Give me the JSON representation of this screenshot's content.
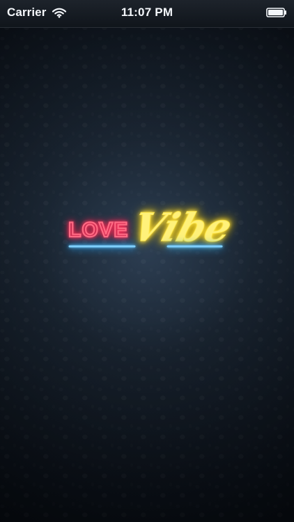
{
  "status_bar": {
    "carrier": "Carrier",
    "time": "11:07 PM"
  },
  "logo": {
    "word1": "LOVE",
    "word2": "Vibe"
  },
  "icons": {
    "wifi": "wifi-icon",
    "battery": "battery-icon"
  },
  "colors": {
    "background_dark": "#0c1118",
    "background_mid": "#18212c",
    "neon_red": "#ff6a83",
    "neon_yellow": "#fff17a",
    "neon_blue": "#7ecfff",
    "status_text": "#f4f7fb"
  }
}
